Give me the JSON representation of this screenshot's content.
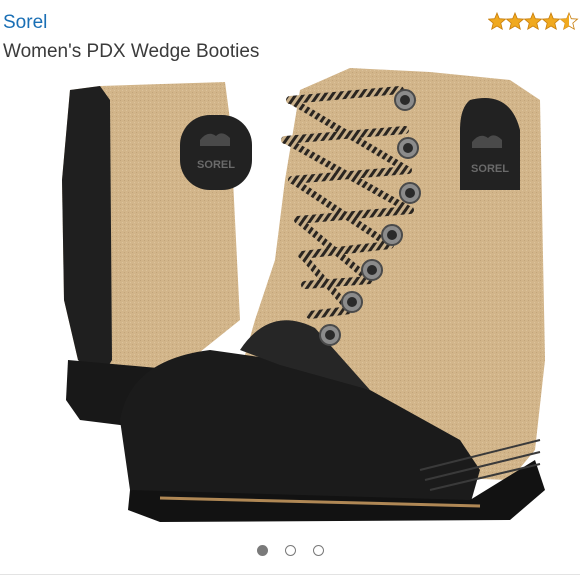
{
  "product": {
    "brand": "Sorel",
    "title": "Women's PDX Wedge Booties",
    "rating": 4.5,
    "logo_text": "SOREL"
  },
  "carousel": {
    "image_count": 3,
    "active_index": 0
  },
  "colors": {
    "brand_link": "#1a6fb5",
    "star_fill": "#f0a91f",
    "canvas": "#d2b58a",
    "leather": "#1d1d1d"
  },
  "icons": {
    "rating": "star-icon",
    "carousel": "dot-indicator-icon"
  }
}
